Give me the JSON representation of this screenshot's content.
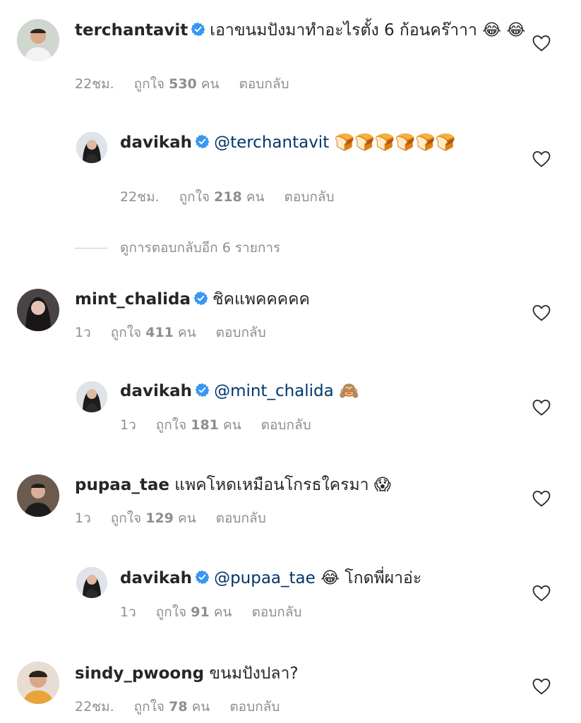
{
  "comments": [
    {
      "username": "terchantavit",
      "text": "เอาขนมปังมาทำอะไรตั้ง 6 ก้อนคร๊าาา 😂 😂",
      "time": "22ชม.",
      "likes_prefix": "ถูกใจ ",
      "likes_count": "530",
      "likes_suffix": " คน",
      "reply_label": "ตอบกลับ"
    },
    {
      "username": "davikah",
      "mention": "@terchantavit",
      "text": " 🍞🍞🍞🍞🍞🍞",
      "time": "22ชม.",
      "likes_prefix": "ถูกใจ ",
      "likes_count": "218",
      "likes_suffix": " คน",
      "reply_label": "ตอบกลับ"
    },
    {
      "username": "mint_chalida",
      "text": "ชิคแพคคคคค",
      "time": "1ว",
      "likes_prefix": "ถูกใจ ",
      "likes_count": "411",
      "likes_suffix": " คน",
      "reply_label": "ตอบกลับ"
    },
    {
      "username": "davikah",
      "mention": "@mint_chalida",
      "text": " 🙈",
      "time": "1ว",
      "likes_prefix": "ถูกใจ ",
      "likes_count": "181",
      "likes_suffix": " คน",
      "reply_label": "ตอบกลับ"
    },
    {
      "username": "pupaa_tae",
      "text": "แพคโหดเหมือนโกรธใครมา 😱",
      "time": "1ว",
      "likes_prefix": "ถูกใจ ",
      "likes_count": "129",
      "likes_suffix": " คน",
      "reply_label": "ตอบกลับ"
    },
    {
      "username": "davikah",
      "mention": "@pupaa_tae",
      "text": " 😂 โกดพี่ผาอ่ะ",
      "time": "1ว",
      "likes_prefix": "ถูกใจ ",
      "likes_count": "91",
      "likes_suffix": " คน",
      "reply_label": "ตอบกลับ"
    },
    {
      "username": "sindy_pwoong",
      "text": "ขนมปังปลา?",
      "time": "22ชม.",
      "likes_prefix": "ถูกใจ ",
      "likes_count": "78",
      "likes_suffix": " คน",
      "reply_label": "ตอบกลับ"
    }
  ],
  "more_replies_label": "ดูการตอบกลับอีก 6 รายการ",
  "icons": {
    "verified": "verified-badge-icon",
    "heart": "heart-outline-icon"
  },
  "colors": {
    "verified_blue": "#3897f0",
    "mention_blue": "#00376b",
    "muted_gray": "#8e8e8e"
  }
}
